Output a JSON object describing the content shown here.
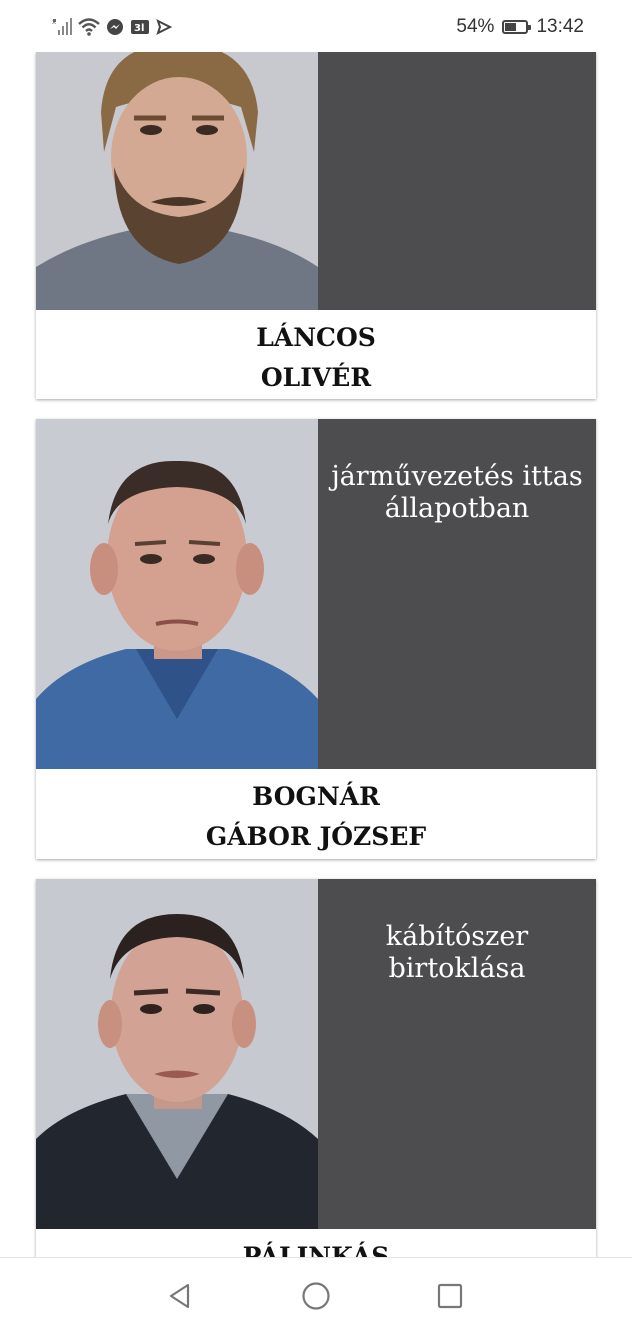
{
  "status_bar": {
    "battery_percent": "54%",
    "battery_level": 0.54,
    "time": "13:42",
    "icons": [
      "signal-icon",
      "wifi-icon",
      "messenger-icon",
      "3d-app-icon",
      "telegram-icon",
      "battery-icon"
    ]
  },
  "cards": [
    {
      "name_line1": "LÁNCOS",
      "name_line2": "OLIVÉR",
      "offense_line1": "",
      "offense_line2": ""
    },
    {
      "name_line1": "BOGNÁR",
      "name_line2": "GÁBOR JÓZSEF",
      "offense_line1": "járművezetés ittas",
      "offense_line2": "állapotban"
    },
    {
      "name_line1": "PÁLINKÁS",
      "name_line2": "",
      "offense_line1": "kábítószer",
      "offense_line2": "birtoklása"
    }
  ],
  "nav_bar": {
    "buttons": [
      "back-icon",
      "home-icon",
      "recents-icon"
    ]
  },
  "colors": {
    "offense_panel": "#4d4d4f",
    "photo_background": "#c9ccd3",
    "card_background": "#ffffff"
  }
}
